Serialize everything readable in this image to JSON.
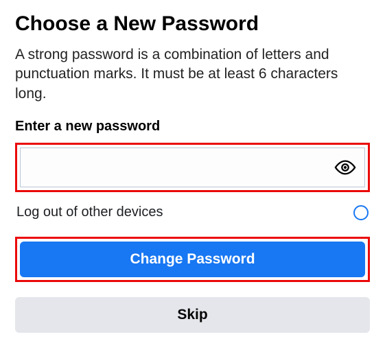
{
  "title": "Choose a New Password",
  "description": "A strong password is a combination of letters and punctuation marks. It must be at least 6 characters long.",
  "field_label": "Enter a new password",
  "password_value": "",
  "password_placeholder": "",
  "logout_label": "Log out of other devices",
  "logout_checked": false,
  "primary_button": "Change Password",
  "secondary_button": "Skip"
}
